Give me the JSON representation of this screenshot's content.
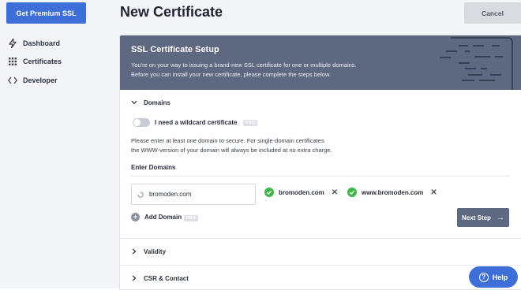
{
  "sidebar": {
    "premium_button": "Get Premium SSL",
    "items": [
      {
        "label": "Dashboard",
        "icon": "bolt-icon"
      },
      {
        "label": "Certificates",
        "icon": "grid-icon"
      },
      {
        "label": "Developer",
        "icon": "code-icon"
      }
    ]
  },
  "header": {
    "title": "New Certificate",
    "cancel_label": "Cancel"
  },
  "setup": {
    "title": "SSL Certificate Setup",
    "subtitle_line1": "You're on your way to issuing a brand-new SSL certificate for one or multiple domains.",
    "subtitle_line2": "Before you can install your new certificate, please complete the steps below."
  },
  "domains_section": {
    "title": "Domains",
    "wildcard_label": "I need a wildcard certificate",
    "wildcard_enabled": false,
    "pro_badge": "PRO",
    "info_line1": "Please enter at least one domain to secure. For single-domain certificates",
    "info_line2": "the WWW-version of your domain will always be included at no extra charge.",
    "enter_label": "Enter Domains",
    "input_value": "bromoden.com",
    "domains": [
      "bromoden.com",
      "www.bromoden.com"
    ],
    "add_domain_label": "Add Domain",
    "next_step_label": "Next Step"
  },
  "sections": {
    "validity": "Validity",
    "csr_contact": "CSR & Contact"
  },
  "help_label": "Help",
  "colors": {
    "accent": "#3e6fd8",
    "header_bg": "#5e6880",
    "success": "#3fb54a"
  }
}
